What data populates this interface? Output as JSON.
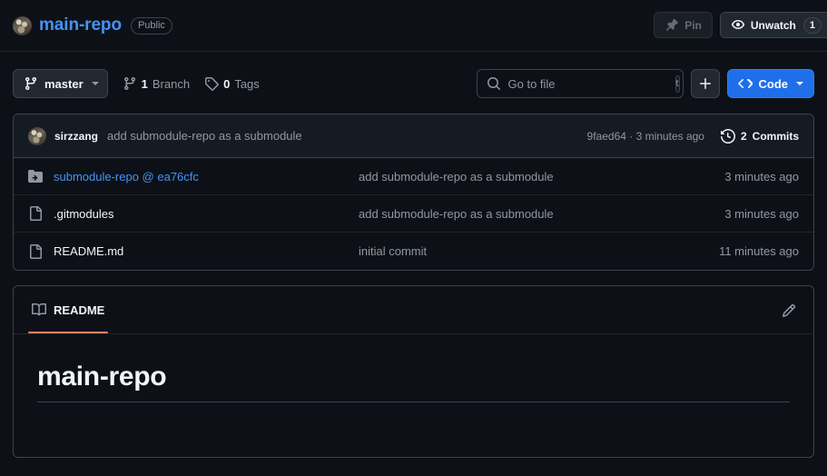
{
  "header": {
    "owner_avatar": "user-avatar",
    "repo_name": "main-repo",
    "visibility": "Public",
    "pin_label": "Pin",
    "watch_label": "Unwatch",
    "watch_count": "1"
  },
  "toolbar": {
    "branch_name": "master",
    "branch_count": "1",
    "branch_label": "Branch",
    "tag_count": "0",
    "tag_label": "Tags",
    "search_placeholder": "Go to file",
    "search_value": "",
    "search_kbd": "t",
    "add_label": "+",
    "code_label": "Code"
  },
  "commit_bar": {
    "author": "sirzzang",
    "message": "add submodule-repo as a submodule",
    "sha_and_time": "9faed64 · 3 minutes ago",
    "commits_count": "2",
    "commits_label": "Commits"
  },
  "files": {
    "rows": [
      {
        "icon": "submodule-icon",
        "name": "submodule-repo @ ea76cfc",
        "is_link": true,
        "commit": "add submodule-repo as a submodule",
        "time": "3 minutes ago"
      },
      {
        "icon": "file-icon",
        "name": ".gitmodules",
        "is_link": false,
        "commit": "add submodule-repo as a submodule",
        "time": "3 minutes ago"
      },
      {
        "icon": "file-icon",
        "name": "README.md",
        "is_link": false,
        "commit": "initial commit",
        "time": "11 minutes ago"
      }
    ]
  },
  "readme": {
    "tab_label": "README",
    "heading": "main-repo"
  },
  "colors": {
    "page_bg": "#0d1117",
    "panel_bg": "#151b23",
    "border": "#3d444d",
    "link": "#4493f8",
    "muted": "#9198a1",
    "accent_blue": "#1f6feb",
    "tab_underline": "#f78166"
  }
}
